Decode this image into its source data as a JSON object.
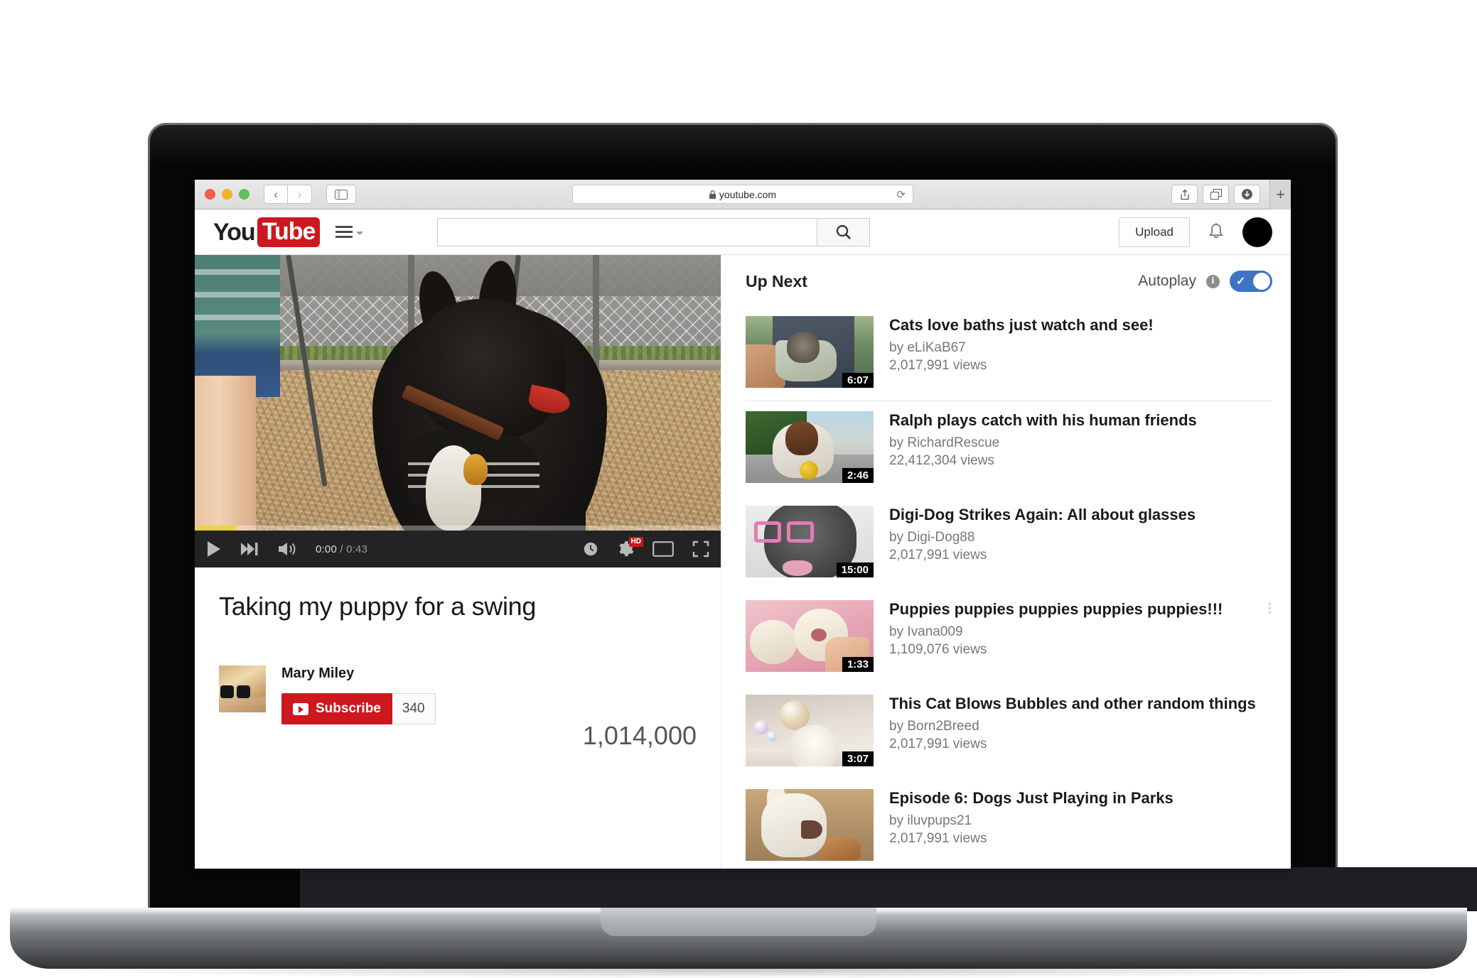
{
  "browser": {
    "url": "youtube.com",
    "lock_icon": "lock-icon",
    "reload_icon": "reload-icon",
    "back_icon": "chevron-left-icon",
    "forward_icon": "chevron-right-icon",
    "sidebar_icon": "sidebar-toggle-icon",
    "share_icon": "share-icon",
    "tabs_icon": "tab-overview-icon",
    "downloads_icon": "downloads-icon",
    "new_tab_label": "+"
  },
  "masthead": {
    "logo_you": "You",
    "logo_tube": "Tube",
    "guide_icon": "hamburger-menu-icon",
    "search_value": "",
    "search_placeholder": "",
    "search_icon": "search-icon",
    "upload_label": "Upload",
    "notifications_icon": "bell-icon",
    "avatar": "account-avatar"
  },
  "player": {
    "play_icon": "play-icon",
    "next_icon": "next-video-icon",
    "volume_icon": "volume-icon",
    "current_time": "0:00",
    "separator": "/",
    "duration": "0:43",
    "clock_icon": "clock-icon",
    "settings_icon": "settings-gear-icon",
    "hd_badge": "HD",
    "theater_icon": "theater-mode-icon",
    "fullscreen_icon": "fullscreen-icon",
    "buffered_percent": 8,
    "progress_percent": 0
  },
  "video": {
    "title": "Taking my puppy for a swing",
    "channel": "Mary Miley",
    "subscribe_label": "Subscribe",
    "subscriber_count": "340",
    "view_count": "1,014,000",
    "channel_avatar": "channel-avatar"
  },
  "sidebar": {
    "heading": "Up Next",
    "autoplay_label": "Autoplay",
    "autoplay_info_icon": "info-icon",
    "autoplay_on": true,
    "toggle_check": "✓",
    "items": [
      {
        "title": "Cats love baths just watch and see!",
        "by": "by eLiKaB67",
        "views": "2,017,991 views",
        "duration": "6:07",
        "thumb": "t1"
      },
      {
        "title": "Ralph plays catch with his human friends",
        "by": "by RichardRescue",
        "views": "22,412,304 views",
        "duration": "2:46",
        "thumb": "t2"
      },
      {
        "title": "Digi-Dog Strikes Again: All about glasses",
        "by": "by Digi-Dog88",
        "views": "2,017,991 views",
        "duration": "15:00",
        "thumb": "t3"
      },
      {
        "title": "Puppies puppies puppies puppies puppies!!!",
        "by": "by Ivana009",
        "views": "1,109,076 views",
        "duration": "1:33",
        "thumb": "t4"
      },
      {
        "title": "This Cat Blows Bubbles and other random things",
        "by": "by Born2Breed",
        "views": "2,017,991 views",
        "duration": "3:07",
        "thumb": "t5"
      },
      {
        "title": "Episode 6: Dogs Just Playing in Parks",
        "by": "by iluvpups21",
        "views": "2,017,991 views",
        "duration": "",
        "thumb": "t6"
      }
    ]
  },
  "colors": {
    "brand_red": "#cc181e",
    "toggle_blue": "#3e72c4",
    "controls_bg": "#232323",
    "buffer_yellow": "#e8d34a"
  }
}
